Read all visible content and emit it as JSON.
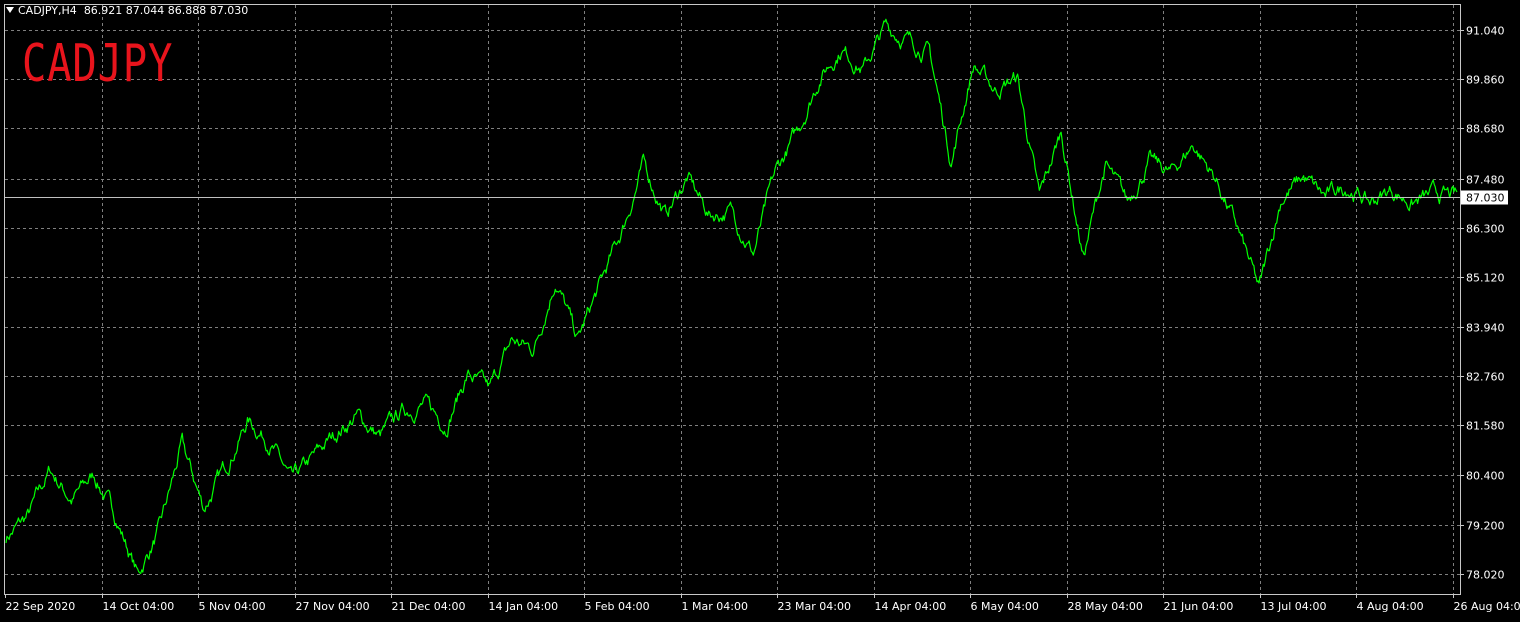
{
  "header": {
    "symbol": "CADJPY,H4",
    "ohlc": "86.921 87.044 86.888 87.030"
  },
  "watermark": "CADJPY",
  "colors": {
    "price": "#00ff00",
    "grid": "#7f7f7f",
    "background": "#000000",
    "watermark": "#e8141c"
  },
  "chart_data": {
    "type": "line",
    "symbol": "CADJPY",
    "timeframe": "H4",
    "grid": true,
    "ylim": [
      77.55,
      91.63
    ],
    "yticks": [
      "91.040",
      "89.860",
      "88.680",
      "87.480",
      "86.300",
      "85.120",
      "83.940",
      "82.760",
      "81.580",
      "80.400",
      "79.200",
      "78.020"
    ],
    "xticks": [
      "22 Sep 2020",
      "14 Oct 04:00",
      "5 Nov 04:00",
      "27 Nov 04:00",
      "21 Dec 04:00",
      "14 Jan 04:00",
      "5 Feb 04:00",
      "1 Mar 04:00",
      "23 Mar 04:00",
      "14 Apr 04:00",
      "6 May 04:00",
      "28 May 04:00",
      "21 Jun 04:00",
      "13 Jul 04:00",
      "4 Aug 04:00",
      "26 Aug 04:00"
    ],
    "current_price": "87.030",
    "series": [
      {
        "x": [
          "22 Sep 2020",
          "2 Oct 2020",
          "14 Oct 2020",
          "22 Oct 2020",
          "26 Oct 2020",
          "2 Nov 2020",
          "5 Nov 2020",
          "6 Nov 2020",
          "11 Nov 2020",
          "17 Nov 2020",
          "23 Nov 2020",
          "30 Nov 2020",
          "4 Dec 2020",
          "10 Dec 2020",
          "16 Dec 2020",
          "21 Dec 2020",
          "29 Dec 2020",
          "4 Jan 2021",
          "10 Jan 2021",
          "14 Jan 2021",
          "22 Jan 2021",
          "28 Jan 2021",
          "4 Feb 2021",
          "10 Feb 2021",
          "16 Feb 2021",
          "22 Feb 2021",
          "25 Feb 2021",
          "1 Mar 2021",
          "5 Mar 2021",
          "9 Mar 2021",
          "15 Mar 2021",
          "23 Mar 2021",
          "27 Mar 2021",
          "2 Apr 2021",
          "8 Apr 2021",
          "14 Apr 2021",
          "18 Apr 2021",
          "21 Apr 2021",
          "27 Apr 2021",
          "1 May 2021",
          "6 May 2021",
          "10 May 2021",
          "16 May 2021",
          "20 May 2021",
          "28 May 2021",
          "3 Jun 2021",
          "9 Jun 2021",
          "13 Jun 2021",
          "17 Jun 2021",
          "21 Jun 2021",
          "25 Jun 2021",
          "29 Jun 2021",
          "3 Jul 2021",
          "7 Jul 2021",
          "13 Jul 2021",
          "15 Jul 2021",
          "17 Jul 2021",
          "21 Jul 2021",
          "27 Jul 2021",
          "31 Jul 2021",
          "4 Aug 2021",
          "10 Aug 2021",
          "16 Aug 2021",
          "20 Aug 2021",
          "24 Aug 2021",
          "26 Aug 2021",
          "27 Aug 2021"
        ],
        "values": [
          78.9,
          79.4,
          80.5,
          79.8,
          80.4,
          79.4,
          78.0,
          79.1,
          81.1,
          79.6,
          80.6,
          81.7,
          81.2,
          80.2,
          80.8,
          81.4,
          81.8,
          81.3,
          81.9,
          82.1,
          81.6,
          82.8,
          82.4,
          83.6,
          83.4,
          85.1,
          83.6,
          84.9,
          86.2,
          87.8,
          86.6,
          87.5,
          86.6,
          86.7,
          85.7,
          87.6,
          88.6,
          89.9,
          90.6,
          90.1,
          91.1,
          90.8,
          90.5,
          87.9,
          90.2,
          89.6,
          89.9,
          87.0,
          88.6,
          85.6,
          87.8,
          86.9,
          87.9,
          87.6,
          88.3,
          87.5,
          86.3,
          84.8,
          87.0,
          87.5,
          87.03,
          87.3,
          86.9,
          87.2,
          86.9,
          87.1,
          87.03
        ]
      }
    ]
  }
}
